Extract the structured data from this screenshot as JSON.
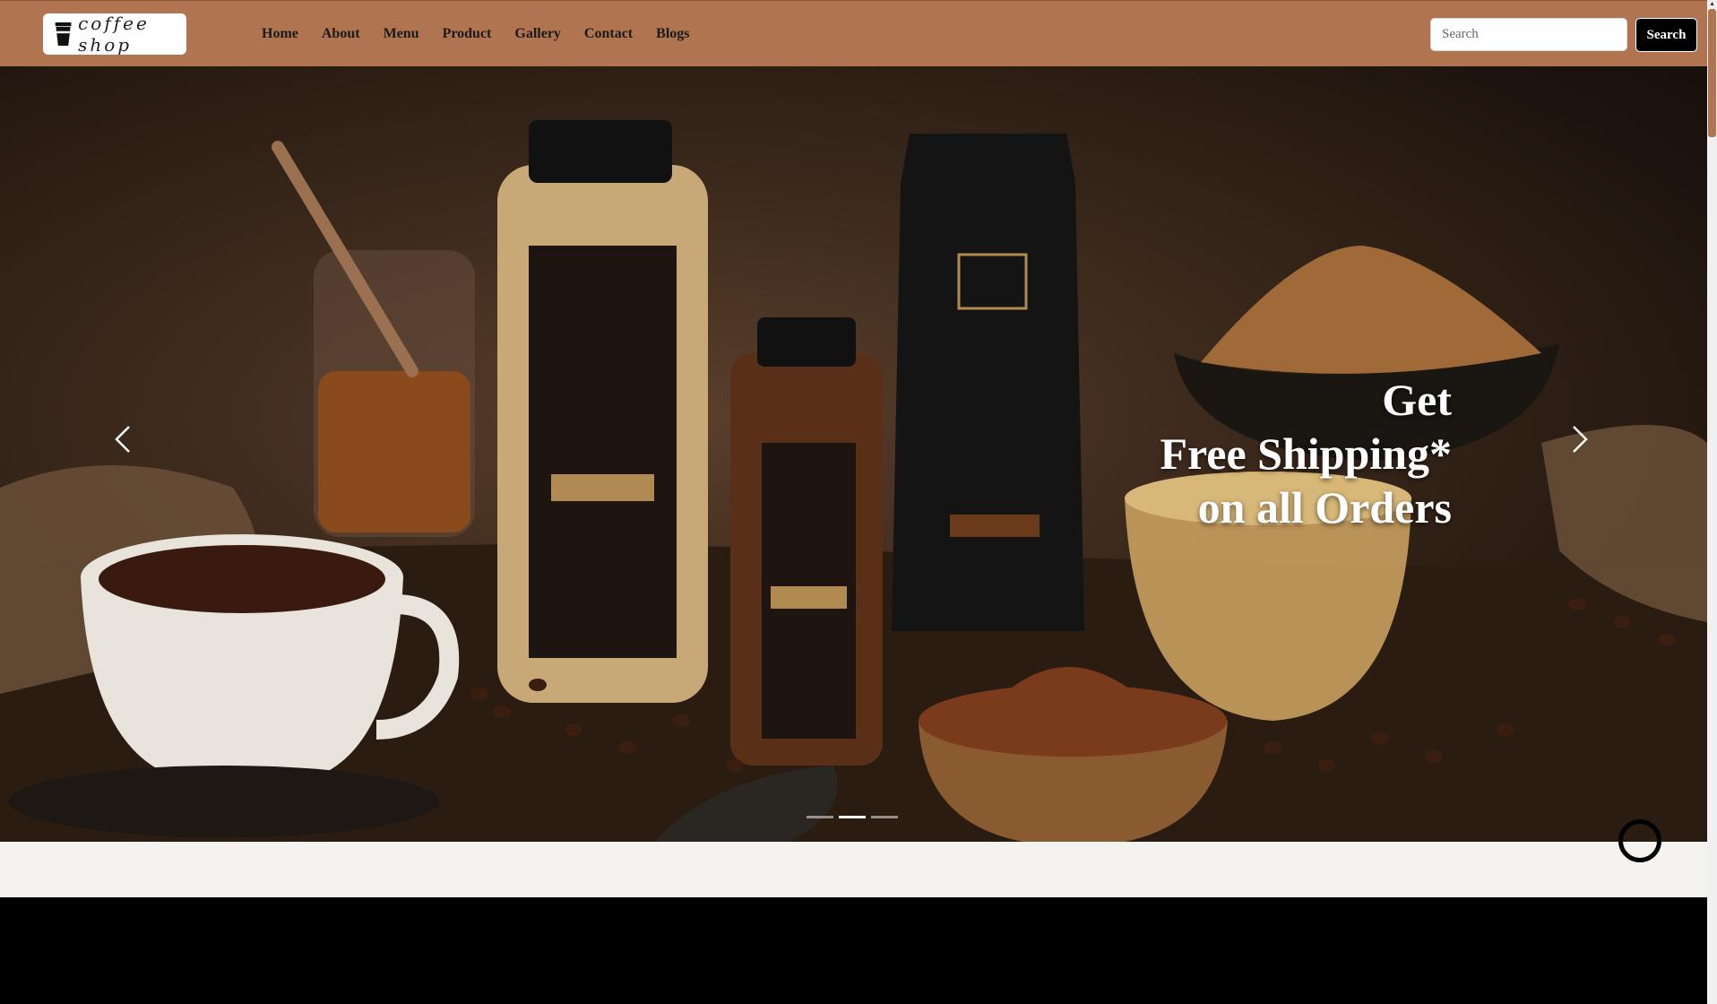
{
  "brand": {
    "logo_text": "coffee shop"
  },
  "nav": {
    "items": [
      {
        "label": "Home"
      },
      {
        "label": "About"
      },
      {
        "label": "Menu"
      },
      {
        "label": "Product"
      },
      {
        "label": "Gallery"
      },
      {
        "label": "Contact"
      },
      {
        "label": "Blogs"
      }
    ]
  },
  "search": {
    "placeholder": "Search",
    "button_label": "Search"
  },
  "hero": {
    "caption_line1": "Get",
    "caption_line2": "Free Shipping*",
    "caption_line3": "on all Orders",
    "slide_count": 3,
    "active_slide": 2
  },
  "colors": {
    "navbar": "#b07550",
    "button": "#000000",
    "strip": "#f5f3f0"
  },
  "icons": {
    "prev": "chevron-left-icon",
    "next": "chevron-right-icon",
    "logo": "coffee-cup-icon"
  }
}
